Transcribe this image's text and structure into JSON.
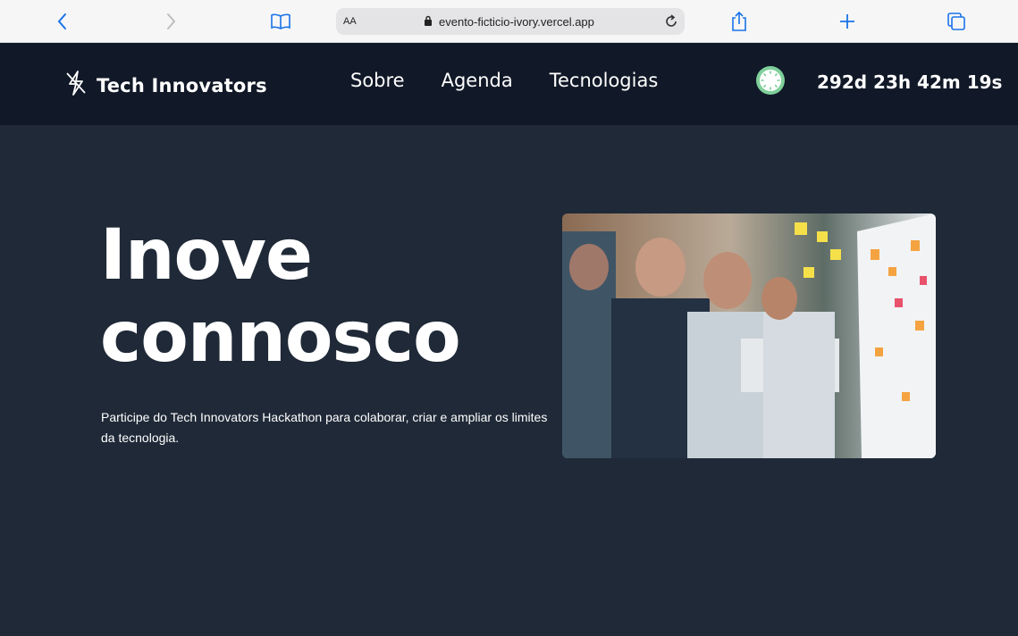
{
  "browser": {
    "reader_label": "AA",
    "url": "evento-ficticio-ivory.vercel.app"
  },
  "site": {
    "brand": "Tech Innovators",
    "nav": [
      {
        "label": "Sobre"
      },
      {
        "label": "Agenda"
      },
      {
        "label": "Tecnologias"
      }
    ],
    "countdown": "292d 23h 42m 19s"
  },
  "hero": {
    "title_line1": "Inove",
    "title_line2": "connosco",
    "description": "Participe do Tech Innovators Hackathon para colaborar, criar e ampliar os limites da tecnologia."
  },
  "colors": {
    "nav_bg": "#111827",
    "page_bg": "#1f2937",
    "clock_accent": "#7fcf9a",
    "browser_accent": "#1a73e8"
  },
  "icons": [
    "back-icon",
    "forward-icon",
    "bookmarks-icon",
    "lock-icon",
    "reload-icon",
    "share-icon",
    "new-tab-icon",
    "tabs-icon",
    "bolt-icon",
    "clock-icon"
  ]
}
